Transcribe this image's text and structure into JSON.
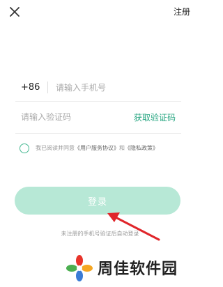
{
  "header": {
    "register_label": "注册"
  },
  "form": {
    "country_code": "+86",
    "phone_placeholder": "请输入手机号",
    "code_placeholder": "请输入验证码",
    "get_code_label": "获取验证码"
  },
  "agreement": {
    "prefix": "我已阅读并同意",
    "user_agreement": "《用户服务协议》",
    "and": "和",
    "privacy_policy": "《隐私政策》"
  },
  "login": {
    "label": "登录"
  },
  "note": "未注册的手机号验证后自动登录",
  "watermark": {
    "text": "周佳软件园"
  },
  "colors": {
    "accent": "#2aa783",
    "button_bg": "#b7e8d6",
    "arrow": "#e0262b"
  }
}
